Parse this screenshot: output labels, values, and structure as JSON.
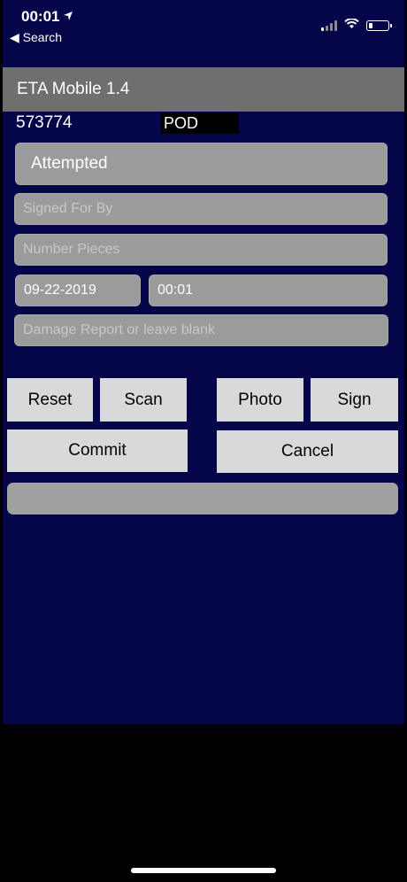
{
  "status_bar": {
    "time": "00:01",
    "location_arrow": "location-arrow-icon",
    "back_label": "◀ Search",
    "signal_icon": "cellular-signal-icon",
    "wifi_icon": "wifi-icon",
    "battery_icon": "battery-icon"
  },
  "header": {
    "title": "ETA Mobile 1.4"
  },
  "order": {
    "id": "573774",
    "badge": "POD"
  },
  "form": {
    "status_value": "Attempted",
    "signed_for_placeholder": "Signed For By",
    "number_pieces_placeholder": "Number Pieces",
    "date_value": "09-22-2019",
    "time_value": "00:01",
    "damage_placeholder": "Damage Report or leave blank"
  },
  "buttons": {
    "reset": "Reset",
    "scan": "Scan",
    "photo": "Photo",
    "sign": "Sign",
    "commit": "Commit",
    "cancel": "Cancel"
  },
  "colors": {
    "app_background": "#05064a",
    "title_bar": "#6f6f6f",
    "field": "#9b9b9b",
    "button": "#d9d9dc"
  }
}
